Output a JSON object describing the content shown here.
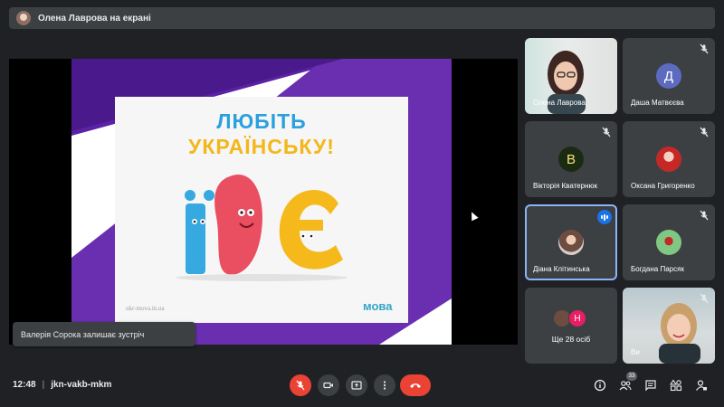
{
  "presenter_bar": {
    "title": "Олена Лаврова на екрані"
  },
  "slide": {
    "title_line1": "ЛЮБІТЬ",
    "title_line2": "УКРАЇНСЬКУ!",
    "url": "ukr-mova.in.ua",
    "brand": "мова"
  },
  "toast": {
    "text": "Валерія Сорока залишає зустріч"
  },
  "participants": [
    {
      "name": "Олена Лаврова",
      "type": "video",
      "muted": false
    },
    {
      "name": "Даша Матвєєва",
      "type": "letter",
      "letter": "Д",
      "avatar_color": "#5c6bc0",
      "muted": true
    },
    {
      "name": "Вікторія Кватернюк",
      "type": "letter",
      "letter": "В",
      "avatar_color": "#1b5e20",
      "muted": true
    },
    {
      "name": "Оксана Григоренко",
      "type": "photo",
      "avatar_color": "#b71c1c",
      "muted": true
    },
    {
      "name": "Діана Клітинська",
      "type": "photo",
      "avatar_color": "#8d6e63",
      "speaking": true
    },
    {
      "name": "Богдана Парсяк",
      "type": "photo",
      "avatar_color": "#4e342e",
      "muted": true
    },
    {
      "more_label": "Ще 28 осіб",
      "letter": "Н"
    },
    {
      "name": "Ви",
      "type": "video",
      "muted": true
    }
  ],
  "bottom": {
    "time": "12:48",
    "meeting_code": "jkn-vakb-mkm",
    "people_count": "33"
  },
  "colors": {
    "accent_blue": "#8ab4f8",
    "danger": "#ea4335",
    "tile_bg": "#3c4043",
    "slide_purple": "#6a2fb0"
  }
}
